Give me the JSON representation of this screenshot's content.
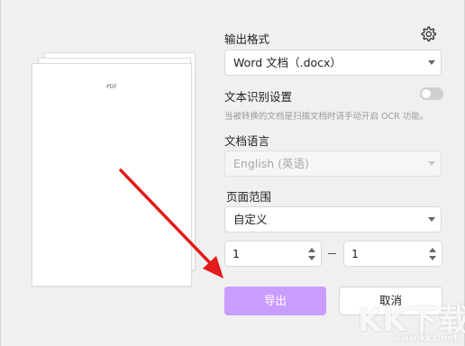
{
  "preview": {
    "page_label": "PDF"
  },
  "output_format": {
    "label": "输出格式",
    "selected": "Word 文档（.docx）"
  },
  "ocr": {
    "label": "文本识别设置",
    "enabled": false,
    "hint": "当被转换的文档是扫描文档时请手动开启 OCR 功能。"
  },
  "language": {
    "label": "文档语言",
    "selected": "English (英语)",
    "disabled": true
  },
  "page_range": {
    "label": "页面范围",
    "selected": "自定义",
    "from": "1",
    "to": "1"
  },
  "buttons": {
    "export": "导出",
    "cancel": "取消"
  },
  "colors": {
    "accent": "#c99cff",
    "arrow": "#e21b1b"
  },
  "watermark": {
    "main": "KK下载",
    "sub": "www.kkx.net"
  }
}
